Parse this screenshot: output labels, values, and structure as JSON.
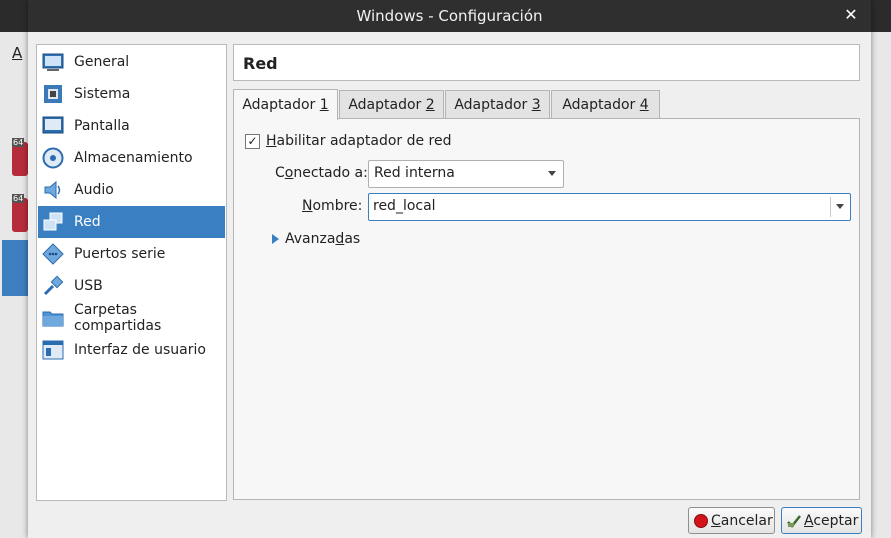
{
  "window": {
    "title": "Windows - Configuración",
    "close_glyph": "✕"
  },
  "background": {
    "menu_letter": "A",
    "vm_badge": "64"
  },
  "categories": [
    {
      "label": "General",
      "icon": "general-icon"
    },
    {
      "label": "Sistema",
      "icon": "system-icon"
    },
    {
      "label": "Pantalla",
      "icon": "display-icon"
    },
    {
      "label": "Almacenamiento",
      "icon": "storage-icon"
    },
    {
      "label": "Audio",
      "icon": "audio-icon"
    },
    {
      "label": "Red",
      "icon": "network-icon",
      "selected": true
    },
    {
      "label": "Puertos serie",
      "icon": "serial-ports-icon"
    },
    {
      "label": "USB",
      "icon": "usb-icon"
    },
    {
      "label": "Carpetas compartidas",
      "icon": "shared-folders-icon"
    },
    {
      "label": "Interfaz de usuario",
      "icon": "user-interface-icon"
    }
  ],
  "section_title": "Red",
  "tabs": [
    {
      "label_pre": "Adaptador ",
      "label_key": "1",
      "active": true
    },
    {
      "label_pre": "Adaptador ",
      "label_key": "2"
    },
    {
      "label_pre": "Adaptador ",
      "label_key": "3"
    },
    {
      "label_pre": "Adaptador ",
      "label_key": "4"
    }
  ],
  "adapter": {
    "enable_label_key": "H",
    "enable_label_rest": "abilitar adaptador de red",
    "enable_checked": true,
    "attached_label_pre": "C",
    "attached_label_key": "o",
    "attached_label_rest": "nectado a:",
    "attached_value": "Red interna",
    "name_label_key": "N",
    "name_label_rest": "ombre:",
    "name_value": "red_local",
    "advanced_pre": "Avanza",
    "advanced_key": "d",
    "advanced_rest": "as"
  },
  "buttons": {
    "cancel_key": "C",
    "cancel_rest": "ancelar",
    "accept_key": "A",
    "accept_rest": "ceptar"
  },
  "colors": {
    "selection": "#3a7fc1",
    "titlebar": "#2f2f2f"
  }
}
